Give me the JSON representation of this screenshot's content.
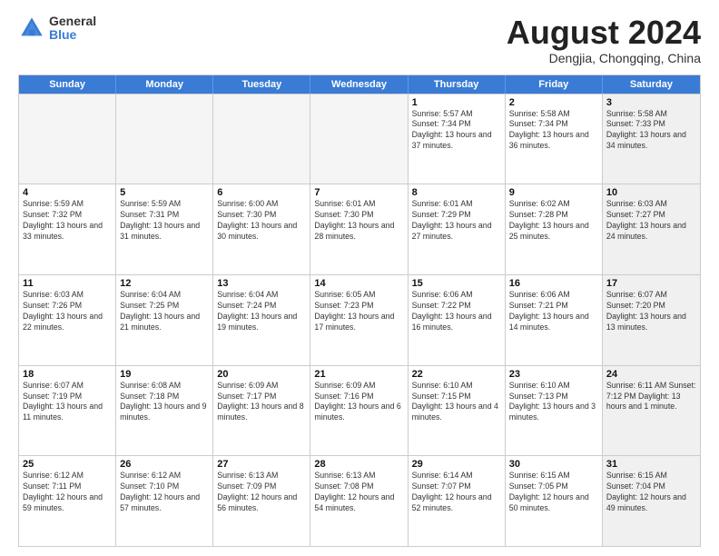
{
  "logo": {
    "general": "General",
    "blue": "Blue"
  },
  "title": "August 2024",
  "location": "Dengjia, Chongqing, China",
  "days_of_week": [
    "Sunday",
    "Monday",
    "Tuesday",
    "Wednesday",
    "Thursday",
    "Friday",
    "Saturday"
  ],
  "rows": [
    [
      {
        "day": "",
        "info": "",
        "empty": true
      },
      {
        "day": "",
        "info": "",
        "empty": true
      },
      {
        "day": "",
        "info": "",
        "empty": true
      },
      {
        "day": "",
        "info": "",
        "empty": true
      },
      {
        "day": "1",
        "info": "Sunrise: 5:57 AM\nSunset: 7:34 PM\nDaylight: 13 hours\nand 37 minutes."
      },
      {
        "day": "2",
        "info": "Sunrise: 5:58 AM\nSunset: 7:34 PM\nDaylight: 13 hours\nand 36 minutes."
      },
      {
        "day": "3",
        "info": "Sunrise: 5:58 AM\nSunset: 7:33 PM\nDaylight: 13 hours\nand 34 minutes.",
        "shaded": true
      }
    ],
    [
      {
        "day": "4",
        "info": "Sunrise: 5:59 AM\nSunset: 7:32 PM\nDaylight: 13 hours\nand 33 minutes."
      },
      {
        "day": "5",
        "info": "Sunrise: 5:59 AM\nSunset: 7:31 PM\nDaylight: 13 hours\nand 31 minutes."
      },
      {
        "day": "6",
        "info": "Sunrise: 6:00 AM\nSunset: 7:30 PM\nDaylight: 13 hours\nand 30 minutes."
      },
      {
        "day": "7",
        "info": "Sunrise: 6:01 AM\nSunset: 7:30 PM\nDaylight: 13 hours\nand 28 minutes."
      },
      {
        "day": "8",
        "info": "Sunrise: 6:01 AM\nSunset: 7:29 PM\nDaylight: 13 hours\nand 27 minutes."
      },
      {
        "day": "9",
        "info": "Sunrise: 6:02 AM\nSunset: 7:28 PM\nDaylight: 13 hours\nand 25 minutes."
      },
      {
        "day": "10",
        "info": "Sunrise: 6:03 AM\nSunset: 7:27 PM\nDaylight: 13 hours\nand 24 minutes.",
        "shaded": true
      }
    ],
    [
      {
        "day": "11",
        "info": "Sunrise: 6:03 AM\nSunset: 7:26 PM\nDaylight: 13 hours\nand 22 minutes."
      },
      {
        "day": "12",
        "info": "Sunrise: 6:04 AM\nSunset: 7:25 PM\nDaylight: 13 hours\nand 21 minutes."
      },
      {
        "day": "13",
        "info": "Sunrise: 6:04 AM\nSunset: 7:24 PM\nDaylight: 13 hours\nand 19 minutes."
      },
      {
        "day": "14",
        "info": "Sunrise: 6:05 AM\nSunset: 7:23 PM\nDaylight: 13 hours\nand 17 minutes."
      },
      {
        "day": "15",
        "info": "Sunrise: 6:06 AM\nSunset: 7:22 PM\nDaylight: 13 hours\nand 16 minutes."
      },
      {
        "day": "16",
        "info": "Sunrise: 6:06 AM\nSunset: 7:21 PM\nDaylight: 13 hours\nand 14 minutes."
      },
      {
        "day": "17",
        "info": "Sunrise: 6:07 AM\nSunset: 7:20 PM\nDaylight: 13 hours\nand 13 minutes.",
        "shaded": true
      }
    ],
    [
      {
        "day": "18",
        "info": "Sunrise: 6:07 AM\nSunset: 7:19 PM\nDaylight: 13 hours\nand 11 minutes."
      },
      {
        "day": "19",
        "info": "Sunrise: 6:08 AM\nSunset: 7:18 PM\nDaylight: 13 hours\nand 9 minutes."
      },
      {
        "day": "20",
        "info": "Sunrise: 6:09 AM\nSunset: 7:17 PM\nDaylight: 13 hours\nand 8 minutes."
      },
      {
        "day": "21",
        "info": "Sunrise: 6:09 AM\nSunset: 7:16 PM\nDaylight: 13 hours\nand 6 minutes."
      },
      {
        "day": "22",
        "info": "Sunrise: 6:10 AM\nSunset: 7:15 PM\nDaylight: 13 hours\nand 4 minutes."
      },
      {
        "day": "23",
        "info": "Sunrise: 6:10 AM\nSunset: 7:13 PM\nDaylight: 13 hours\nand 3 minutes."
      },
      {
        "day": "24",
        "info": "Sunrise: 6:11 AM\nSunset: 7:12 PM\nDaylight: 13 hours\nand 1 minute.",
        "shaded": true
      }
    ],
    [
      {
        "day": "25",
        "info": "Sunrise: 6:12 AM\nSunset: 7:11 PM\nDaylight: 12 hours\nand 59 minutes."
      },
      {
        "day": "26",
        "info": "Sunrise: 6:12 AM\nSunset: 7:10 PM\nDaylight: 12 hours\nand 57 minutes."
      },
      {
        "day": "27",
        "info": "Sunrise: 6:13 AM\nSunset: 7:09 PM\nDaylight: 12 hours\nand 56 minutes."
      },
      {
        "day": "28",
        "info": "Sunrise: 6:13 AM\nSunset: 7:08 PM\nDaylight: 12 hours\nand 54 minutes."
      },
      {
        "day": "29",
        "info": "Sunrise: 6:14 AM\nSunset: 7:07 PM\nDaylight: 12 hours\nand 52 minutes."
      },
      {
        "day": "30",
        "info": "Sunrise: 6:15 AM\nSunset: 7:05 PM\nDaylight: 12 hours\nand 50 minutes."
      },
      {
        "day": "31",
        "info": "Sunrise: 6:15 AM\nSunset: 7:04 PM\nDaylight: 12 hours\nand 49 minutes.",
        "shaded": true
      }
    ]
  ]
}
